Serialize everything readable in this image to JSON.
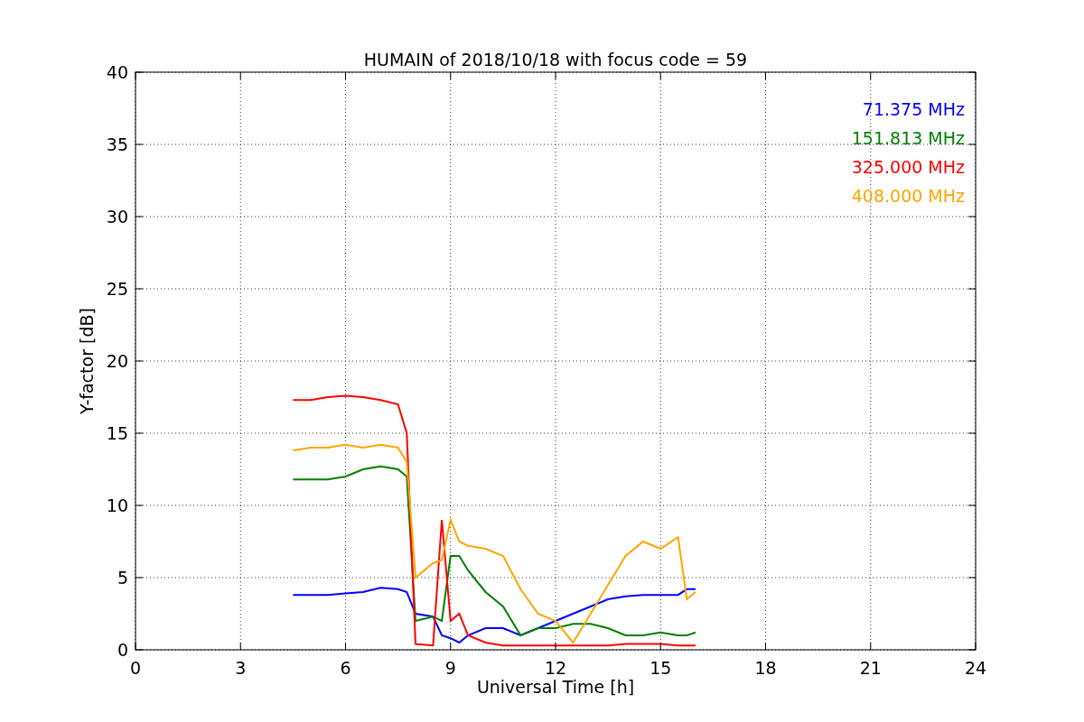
{
  "chart_data": {
    "type": "line",
    "title": "HUMAIN of 2018/10/18 with focus code = 59",
    "xlabel": "Universal Time [h]",
    "ylabel": "Y-factor [dB]",
    "x": [
      4.5,
      5,
      5.5,
      6,
      6.5,
      7,
      7.5,
      7.75,
      8,
      8.5,
      8.75,
      9,
      9.25,
      9.5,
      10,
      10.5,
      11,
      11.5,
      12,
      12.5,
      13,
      13.5,
      14,
      14.5,
      15,
      15.5,
      15.75,
      16
    ],
    "series": [
      {
        "name": "71.375 MHz",
        "color": "#0000ff",
        "values": [
          3.8,
          3.8,
          3.8,
          3.9,
          4.0,
          4.3,
          4.2,
          4.0,
          2.5,
          2.3,
          1.0,
          0.8,
          0.5,
          1.0,
          1.5,
          1.5,
          1.0,
          1.5,
          2.0,
          2.5,
          3.0,
          3.5,
          3.7,
          3.8,
          3.8,
          3.8,
          4.2,
          4.2
        ]
      },
      {
        "name": "151.813 MHz",
        "color": "#008000",
        "values": [
          11.8,
          11.8,
          11.8,
          12.0,
          12.5,
          12.7,
          12.5,
          12.0,
          2.0,
          2.3,
          2.0,
          6.5,
          6.5,
          5.5,
          4.0,
          3.0,
          1.0,
          1.5,
          1.5,
          1.8,
          1.8,
          1.5,
          1.0,
          1.0,
          1.2,
          1.0,
          1.0,
          1.2
        ]
      },
      {
        "name": "325.000 MHz",
        "color": "#ff0000",
        "values": [
          17.3,
          17.3,
          17.5,
          17.6,
          17.5,
          17.3,
          17.0,
          15.0,
          0.4,
          0.3,
          9.0,
          2.0,
          2.5,
          1.0,
          0.5,
          0.3,
          0.3,
          0.3,
          0.3,
          0.3,
          0.3,
          0.3,
          0.4,
          0.4,
          0.4,
          0.3,
          0.3,
          0.3
        ]
      },
      {
        "name": "408.000 MHz",
        "color": "#ffa500",
        "values": [
          13.8,
          14.0,
          14.0,
          14.2,
          14.0,
          14.2,
          14.0,
          13.0,
          5.0,
          6.0,
          6.2,
          9.0,
          7.5,
          7.2,
          7.0,
          6.5,
          4.2,
          2.5,
          2.0,
          0.5,
          2.5,
          4.5,
          6.5,
          7.5,
          7.0,
          7.8,
          3.5,
          4.0
        ]
      }
    ],
    "xlim": [
      0,
      24
    ],
    "ylim": [
      0,
      40
    ],
    "xticks": [
      0,
      3,
      6,
      9,
      12,
      15,
      18,
      21,
      24
    ],
    "yticks": [
      0,
      5,
      10,
      15,
      20,
      25,
      30,
      35,
      40
    ],
    "grid": true
  }
}
